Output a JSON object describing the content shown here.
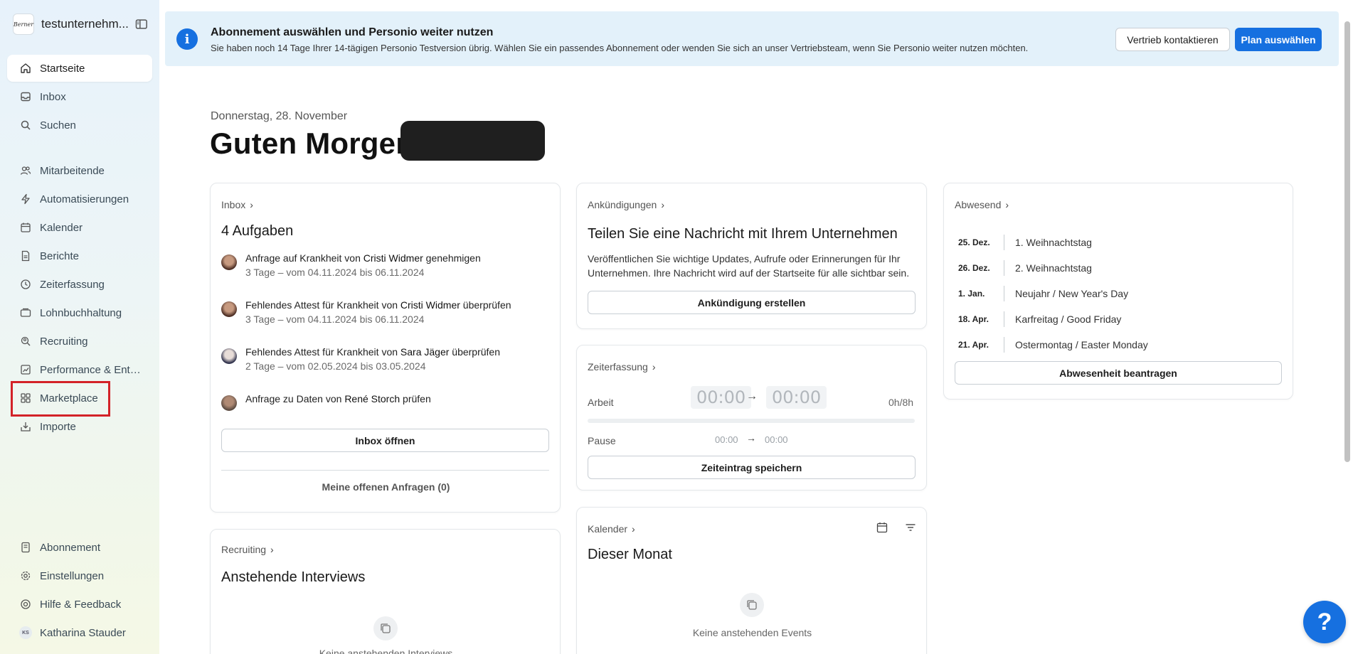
{
  "sidebar": {
    "workspace_name": "testunternehm...",
    "workspace_logo_text": "Berner",
    "items_top": [
      {
        "label": "Startseite",
        "icon": "home-icon"
      },
      {
        "label": "Inbox",
        "icon": "inbox-icon"
      },
      {
        "label": "Suchen",
        "icon": "search-icon"
      }
    ],
    "items_main": [
      {
        "label": "Mitarbeitende",
        "icon": "people-icon"
      },
      {
        "label": "Automatisierungen",
        "icon": "lightning-icon"
      },
      {
        "label": "Kalender",
        "icon": "calendar-icon"
      },
      {
        "label": "Berichte",
        "icon": "report-icon"
      },
      {
        "label": "Zeiterfassung",
        "icon": "clock-icon"
      },
      {
        "label": "Lohnbuchhaltung",
        "icon": "payroll-icon"
      },
      {
        "label": "Recruiting",
        "icon": "recruiting-icon"
      },
      {
        "label": "Performance & Entwic...",
        "icon": "performance-icon"
      },
      {
        "label": "Marketplace",
        "icon": "grid-icon"
      },
      {
        "label": "Importe",
        "icon": "import-icon"
      }
    ],
    "items_bottom": [
      {
        "label": "Abonnement",
        "icon": "subscription-icon"
      },
      {
        "label": "Einstellungen",
        "icon": "gear-icon"
      },
      {
        "label": "Hilfe & Feedback",
        "icon": "lifebuoy-icon"
      },
      {
        "label": "Katharina Stauder",
        "icon": "user-avatar",
        "initials": "KS"
      }
    ]
  },
  "banner": {
    "title": "Abonnement auswählen und Personio weiter nutzen",
    "text": "Sie haben noch 14 Tage Ihrer 14-tägigen Personio Testversion übrig. Wählen Sie ein passendes Abonnement oder wenden Sie sich an unser Vertriebsteam, wenn Sie Personio weiter nutzen möchten.",
    "contact_label": "Vertrieb kontaktieren",
    "plan_label": "Plan auswählen"
  },
  "greeting": {
    "date": "Donnerstag, 28. November",
    "text": "Guten Morgen,"
  },
  "inbox": {
    "head": "Inbox",
    "title": "4 Aufgaben",
    "tasks": [
      {
        "pre": "Anfrage auf Krankheit von ",
        "name": "Cristi Widmer",
        "post": " genehmigen",
        "sub": "3 Tage – vom 04.11.2024 bis 06.11.2024"
      },
      {
        "pre": "Fehlendes Attest für Krankheit von ",
        "name": "Cristi Widmer",
        "post": " überprüfen",
        "sub": "3 Tage – vom 04.11.2024 bis 06.11.2024"
      },
      {
        "pre": "Fehlendes Attest für Krankheit von ",
        "name": "Sara Jäger",
        "post": " überprüfen",
        "sub": "2 Tage – vom 02.05.2024 bis 03.05.2024"
      },
      {
        "pre": "Anfrage zu Daten von ",
        "name": "René Storch",
        "post": " prüfen",
        "sub": ""
      }
    ],
    "open_button": "Inbox öffnen",
    "my_requests": "Meine offenen Anfragen (0)"
  },
  "recruiting": {
    "head": "Recruiting",
    "title": "Anstehende Interviews",
    "empty": "Keine anstehenden Interviews"
  },
  "announcements": {
    "head": "Ankündigungen",
    "title": "Teilen Sie eine Nachricht mit Ihrem Unternehmen",
    "text1": "Veröffentlichen Sie wichtige Updates, Aufrufe oder Erinnerungen für Ihr",
    "text2": "Unternehmen. Ihre Nachricht wird auf der Startseite für alle sichtbar sein.",
    "button": "Ankündigung erstellen"
  },
  "time_tracking": {
    "head": "Zeiterfassung",
    "work_label": "Arbeit",
    "work_start": "00:00",
    "work_end": "00:00",
    "work_total": "0h/8h",
    "pause_label": "Pause",
    "pause_start": "00:00",
    "pause_end": "00:00",
    "button": "Zeiteintrag speichern"
  },
  "calendar": {
    "head": "Kalender",
    "title": "Dieser Monat",
    "empty": "Keine anstehenden Events"
  },
  "absent": {
    "head": "Abwesend",
    "rows": [
      {
        "date": "25. Dez.",
        "name": "1. Weihnachtstag"
      },
      {
        "date": "26. Dez.",
        "name": "2. Weihnachtstag"
      },
      {
        "date": "1. Jan.",
        "name": "Neujahr / New Year's Day"
      },
      {
        "date": "18. Apr.",
        "name": "Karfreitag / Good Friday"
      },
      {
        "date": "21. Apr.",
        "name": "Ostermontag / Easter Monday"
      }
    ],
    "button": "Abwesenheit beantragen"
  },
  "help_label": "?",
  "colors": {
    "accent": "#1670e0",
    "highlight": "#d32228",
    "banner_bg": "#e3f1fa"
  }
}
